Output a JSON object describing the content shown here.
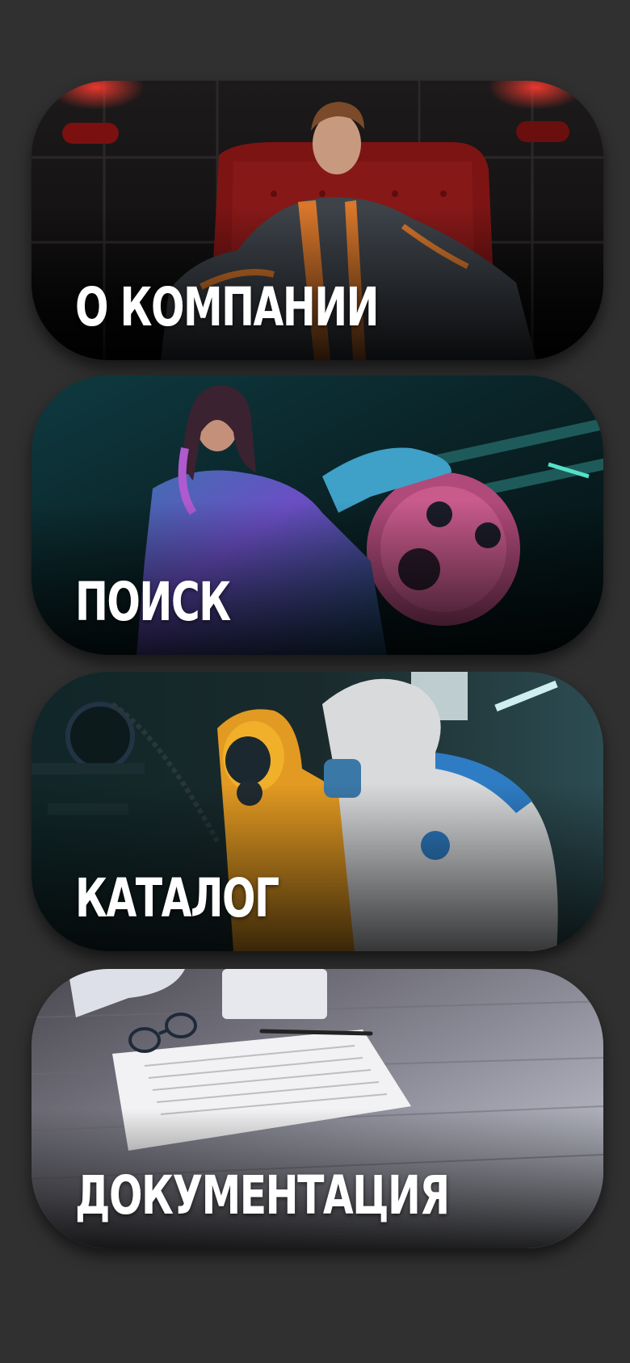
{
  "menu": {
    "items": [
      {
        "label": "О КОМПАНИИ",
        "image": "person-in-protective-suit-red-armchair"
      },
      {
        "label": "ПОИСК",
        "image": "woman-in-protective-suit-with-machinery"
      },
      {
        "label": "КАТАЛОГ",
        "image": "workers-in-hazmat-suits-and-respirators"
      },
      {
        "label": "ДОКУМЕНТАЦИЯ",
        "image": "documents-glasses-pen-on-wooden-desk"
      }
    ]
  },
  "colors": {
    "background": "#303030",
    "label": "#ffffff"
  }
}
